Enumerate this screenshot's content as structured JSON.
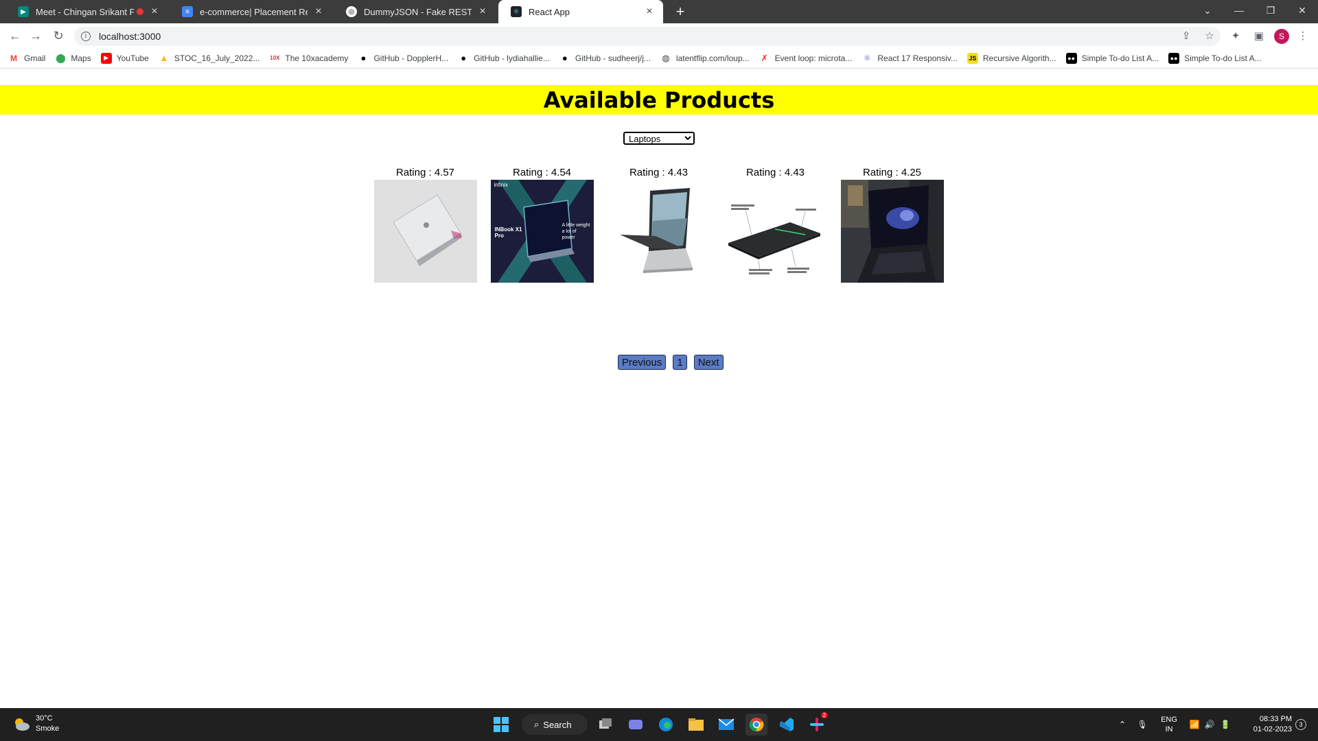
{
  "browser": {
    "tabs": [
      {
        "title": "Meet - Chingan Srikant Prakas",
        "icon": "google-meet-icon",
        "recording": true
      },
      {
        "title": "e-commerce| Placement Readiness",
        "icon": "google-docs-icon"
      },
      {
        "title": "DummyJSON - Fake REST API of",
        "icon": "dummyjson-icon"
      },
      {
        "title": "React App",
        "icon": "react-icon",
        "active": true
      }
    ],
    "url": "localhost:3000",
    "profile_initial": "S",
    "bookmarks": [
      {
        "label": "Gmail",
        "icon": "gmail-icon"
      },
      {
        "label": "Maps",
        "icon": "maps-icon"
      },
      {
        "label": "YouTube",
        "icon": "youtube-icon"
      },
      {
        "label": "STOC_16_July_2022...",
        "icon": "drive-icon"
      },
      {
        "label": "The 10xacademy",
        "icon": "10x-icon"
      },
      {
        "label": "GitHub - DopplerH...",
        "icon": "github-icon"
      },
      {
        "label": "GitHub - lydiahallie...",
        "icon": "github-icon"
      },
      {
        "label": "GitHub - sudheerj/j...",
        "icon": "github-icon"
      },
      {
        "label": "latentflip.com/loup...",
        "icon": "globe-icon"
      },
      {
        "label": "Event loop: microta...",
        "icon": "figure-icon"
      },
      {
        "label": "React 17 Responsiv...",
        "icon": "react-icon"
      },
      {
        "label": "Recursive Algorith...",
        "icon": "js-icon"
      },
      {
        "label": "Simple To-do List A...",
        "icon": "medium-icon"
      },
      {
        "label": "Simple To-do List A...",
        "icon": "medium-icon"
      }
    ]
  },
  "page": {
    "heading": "Available Products",
    "category_select": {
      "selected": "Laptops"
    },
    "products": [
      {
        "rating_label": "Rating : 4.57",
        "image": "laptop-silver-macbook"
      },
      {
        "rating_label": "Rating : 4.54",
        "image": "laptop-infinix-inbook"
      },
      {
        "rating_label": "Rating : 4.43",
        "image": "laptop-surface"
      },
      {
        "rating_label": "Rating : 4.43",
        "image": "laptop-black-side"
      },
      {
        "rating_label": "Rating : 4.25",
        "image": "laptop-desk-photo"
      }
    ],
    "infinix_brand": "infinix",
    "infinix_model": "INBook X1 Pro",
    "infinix_tagline": "A little weight a lot of power",
    "pagination": {
      "previous": "Previous",
      "page": "1",
      "next": "Next"
    }
  },
  "taskbar": {
    "weather_temp": "30°C",
    "weather_desc": "Smoke",
    "search_label": "Search",
    "lang_top": "ENG",
    "lang_bottom": "IN",
    "time": "08:33 PM",
    "date": "01-02-2023",
    "notification_count": "3",
    "slack_badge": "2"
  },
  "colors": {
    "header_bar": "#ffff00",
    "pagination_button": "#5b7bc4",
    "tabstrip": "#3c3c3c",
    "taskbar": "#202020"
  }
}
